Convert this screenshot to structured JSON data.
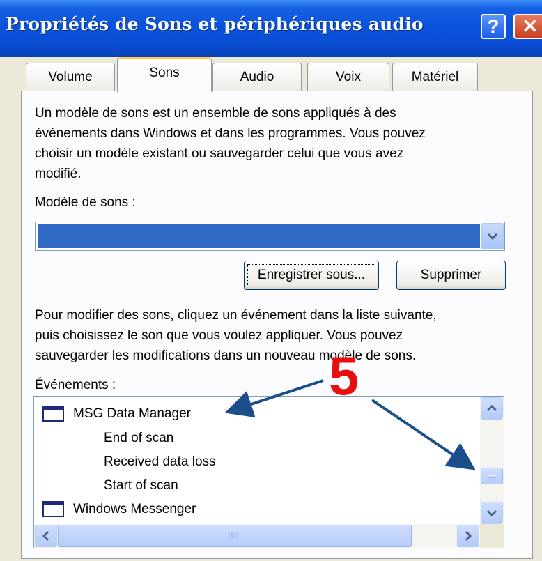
{
  "window": {
    "title": "Propriétés de Sons et périphériques audio",
    "help_label": "?",
    "close_label": "✕"
  },
  "tabs": [
    {
      "label": "Volume",
      "active": false
    },
    {
      "label": "Sons",
      "active": true
    },
    {
      "label": "Audio",
      "active": false
    },
    {
      "label": "Voix",
      "active": false
    },
    {
      "label": "Matériel",
      "active": false
    }
  ],
  "intro": {
    "lines": [
      "Un modèle de sons est un ensemble de sons appliqués à des",
      "événements dans Windows et dans les programmes. Vous pouvez",
      "choisir un modèle existant ou sauvegarder celui que vous avez",
      "modifié."
    ]
  },
  "scheme": {
    "label": "Modèle de sons :",
    "value": ""
  },
  "buttons": {
    "save_as": "Enregistrer sous...",
    "delete": "Supprimer"
  },
  "instructions": {
    "lines": [
      "Pour modifier des sons, cliquez un événement dans la liste suivante,",
      "puis choisissez le son que vous voulez appliquer. Vous pouvez",
      "sauvegarder les modifications dans un nouveau modèle de sons."
    ]
  },
  "events": {
    "label": "Événements :",
    "items": [
      {
        "label": "MSG Data Manager",
        "type": "group"
      },
      {
        "label": "End of scan",
        "type": "event"
      },
      {
        "label": "Received data loss",
        "type": "event"
      },
      {
        "label": "Start of scan",
        "type": "event"
      },
      {
        "label": "Windows Messenger",
        "type": "group"
      }
    ]
  },
  "annotation": {
    "number": "5",
    "color": "#e60e0e",
    "arrow_color": "#1a4f8c"
  },
  "colors": {
    "titlebar": "#0a52da",
    "selection": "#316ac5",
    "tab_highlight": "#ffc83c",
    "dialog_bg": "#ece9d8"
  }
}
